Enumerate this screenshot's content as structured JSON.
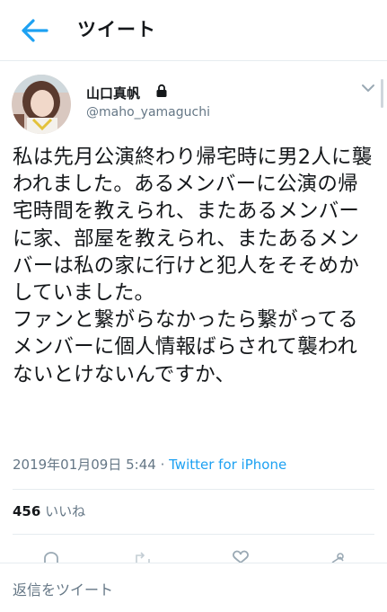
{
  "header": {
    "title": "ツイート",
    "back_icon": "arrow-left-icon"
  },
  "colors": {
    "accent": "#1da1f2",
    "text": "#14171a",
    "secondary": "#657786",
    "divider": "#e6ecf0"
  },
  "tweet": {
    "author_name": "山口真帆",
    "author_handle": "@maho_yamaguchi",
    "protected_icon": "lock-icon",
    "text": "私は先月公演終わり帰宅時に男2人に襲われました。あるメンバーに公演の帰宅時間を教えられ、またあるメンバーに家、部屋を教えられ、またあるメンバーは私の家に行けと犯人をそそめかしていました。\nファンと繋がらなかったら繋がってるメンバーに個人情報ばらされて襲われないとけないんですか、",
    "timestamp": "2019年01月09日 5:44",
    "separator": " · ",
    "source": "Twitter for iPhone",
    "likes_count": "456",
    "likes_label": "いいね"
  },
  "actions": [
    "reply-icon",
    "retweet-icon",
    "like-icon",
    "share-icon"
  ],
  "reply_bar": {
    "placeholder": "返信をツイート"
  }
}
